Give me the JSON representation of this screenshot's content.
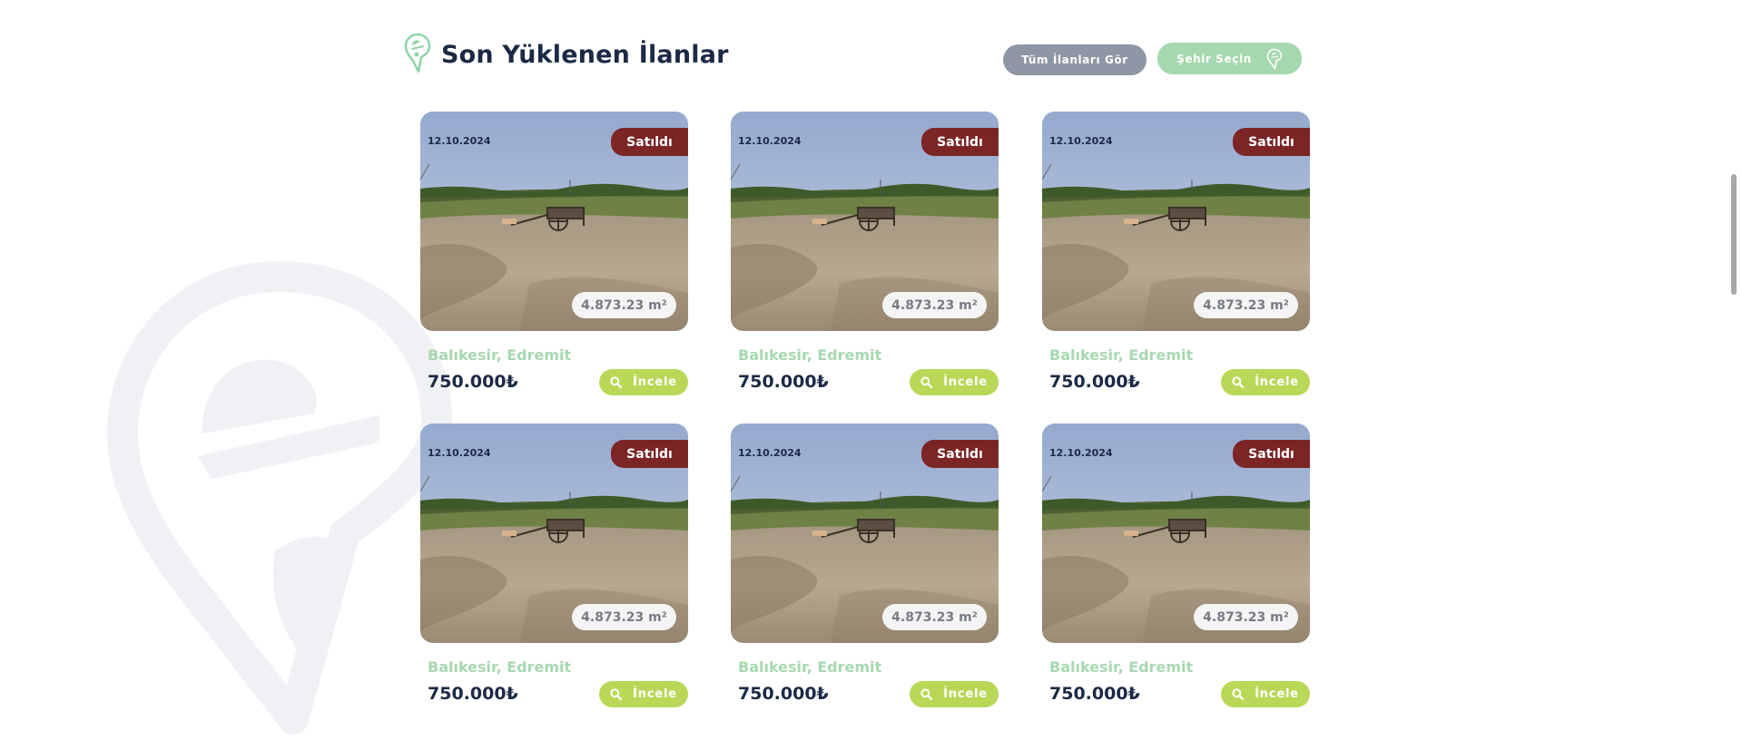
{
  "header": {
    "title": "Son Yüklenen İlanlar",
    "all_listings_label": "Tüm İlanları Gör",
    "city_select_label": "Şehir Seçin"
  },
  "listings": [
    {
      "date": "12.10.2024",
      "status": "Satıldı",
      "area": "4.873.23 m²",
      "location": "Balıkesir, Edremit",
      "price": "750.000₺",
      "button": "İncele"
    },
    {
      "date": "12.10.2024",
      "status": "Satıldı",
      "area": "4.873.23 m²",
      "location": "Balıkesir, Edremit",
      "price": "750.000₺",
      "button": "İncele"
    },
    {
      "date": "12.10.2024",
      "status": "Satıldı",
      "area": "4.873.23 m²",
      "location": "Balıkesir, Edremit",
      "price": "750.000₺",
      "button": "İncele"
    },
    {
      "date": "12.10.2024",
      "status": "Satıldı",
      "area": "4.873.23 m²",
      "location": "Balıkesir, Edremit",
      "price": "750.000₺",
      "button": "İncele"
    },
    {
      "date": "12.10.2024",
      "status": "Satıldı",
      "area": "4.873.23 m²",
      "location": "Balıkesir, Edremit",
      "price": "750.000₺",
      "button": "İncele"
    },
    {
      "date": "12.10.2024",
      "status": "Satıldı",
      "area": "4.873.23 m²",
      "location": "Balıkesir, Edremit",
      "price": "750.000₺",
      "button": "İncele"
    }
  ],
  "colors": {
    "title": "#1b2a45",
    "sold_badge": "#7b2526",
    "location_text": "#a8d8b0",
    "inspect_button": "#b9d857",
    "all_button": "#8f96a5",
    "city_button": "#a6d8af"
  },
  "icons": {
    "header": "location-pin-logo-icon",
    "city_button": "location-pin-logo-icon",
    "inspect_button": "search-icon",
    "background": "location-pin-logo-watermark"
  }
}
